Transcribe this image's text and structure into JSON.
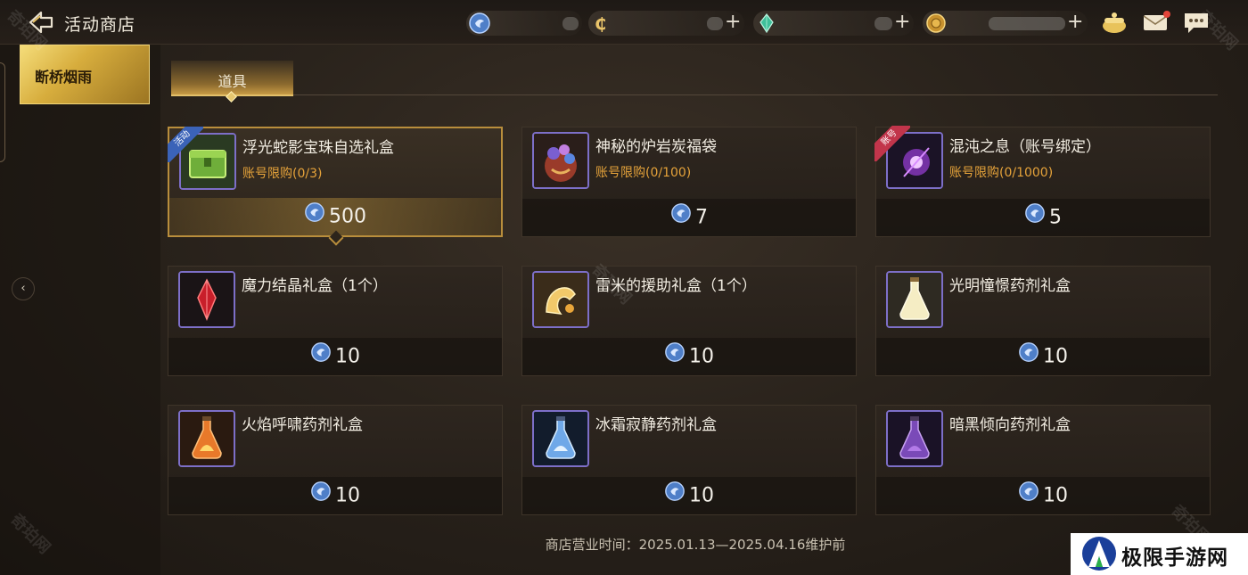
{
  "header": {
    "title": "活动商店",
    "resources": [
      {
        "icon": "blue-gem-icon",
        "plus": ""
      },
      {
        "icon": "gold-c-coin-icon",
        "plus": "+"
      },
      {
        "icon": "green-crystal-icon",
        "plus": "+"
      },
      {
        "icon": "gold-medal-coin-icon",
        "plus": "+"
      }
    ],
    "icons": [
      "treasure-pot-icon",
      "mail-icon",
      "chat-icon"
    ]
  },
  "sidebar": {
    "items": [
      {
        "label": "断桥烟雨"
      }
    ]
  },
  "tabs": [
    {
      "label": "道具"
    }
  ],
  "products": [
    {
      "name": "浮光蛇影宝珠自选礼盒",
      "limit": "账号限购(0/3)",
      "price": "500",
      "badge": "活动",
      "icon": "green-chest-icon"
    },
    {
      "name": "神秘的炉岩炭福袋",
      "limit": "账号限购(0/100)",
      "price": "7",
      "badge": "",
      "icon": "lucky-bag-icon"
    },
    {
      "name": "混沌之息（账号绑定）",
      "limit": "账号限购(0/1000)",
      "price": "5",
      "badge": "账号",
      "icon": "purple-orb-icon"
    },
    {
      "name": "魔力结晶礼盒（1个）",
      "limit": "",
      "price": "10",
      "badge": "",
      "icon": "red-crystal-icon"
    },
    {
      "name": "雷米的援助礼盒（1个）",
      "limit": "",
      "price": "10",
      "badge": "",
      "icon": "golden-hand-icon"
    },
    {
      "name": "光明憧憬药剂礼盒",
      "limit": "",
      "price": "10",
      "badge": "",
      "icon": "light-potion-icon"
    },
    {
      "name": "火焰呼啸药剂礼盒",
      "limit": "",
      "price": "10",
      "badge": "",
      "icon": "fire-potion-icon"
    },
    {
      "name": "冰霜寂静药剂礼盒",
      "limit": "",
      "price": "10",
      "badge": "",
      "icon": "frost-potion-icon"
    },
    {
      "name": "暗黑倾向药剂礼盒",
      "limit": "",
      "price": "10",
      "badge": "",
      "icon": "dark-potion-icon"
    }
  ],
  "footer": {
    "hours": "商店营业时间：2025.01.13—2025.04.16维护前"
  },
  "watermark": {
    "text": "奇珀网",
    "brand": "极限手游网"
  },
  "colors": {
    "accent_gold": "#d7ad3d",
    "limit_orange": "#e6a33a",
    "currency_blue": "#5b8fd6"
  }
}
